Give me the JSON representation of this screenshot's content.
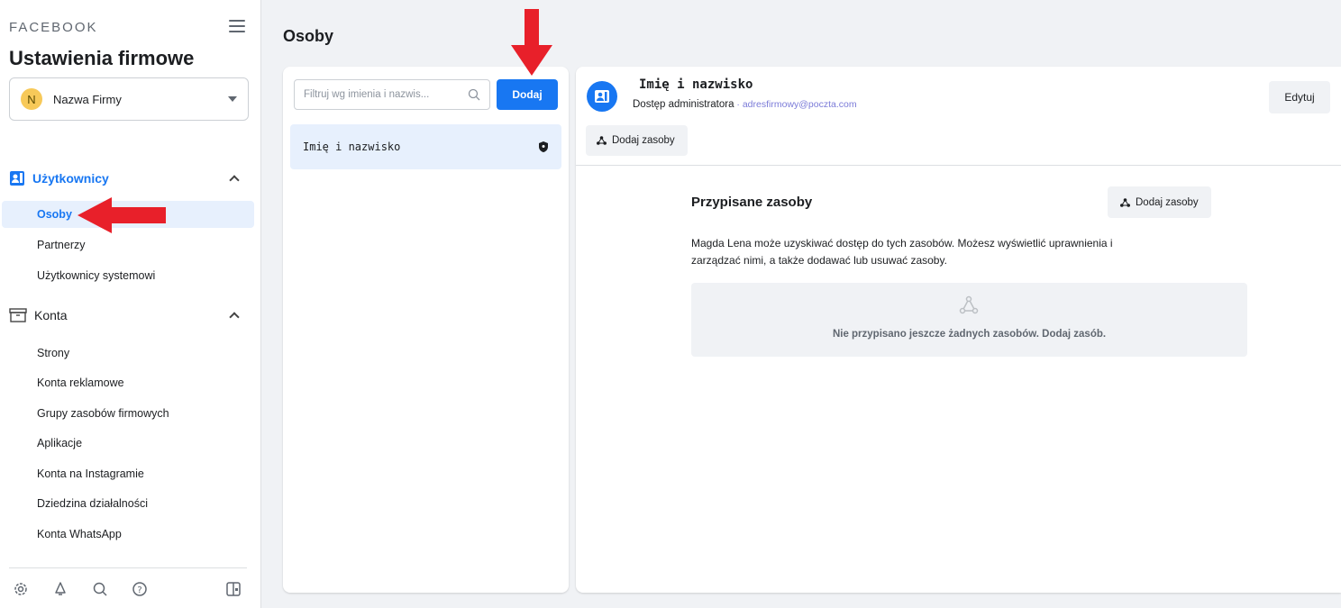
{
  "sidebar": {
    "brand": "FACEBOOK",
    "title": "Ustawienia firmowe",
    "business": {
      "initial": "N",
      "name": "Nazwa Firmy"
    },
    "users_section": {
      "label": "Użytkownicy",
      "items": [
        "Osoby",
        "Partnerzy",
        "Użytkownicy systemowi"
      ]
    },
    "accounts_section": {
      "label": "Konta",
      "items": [
        "Strony",
        "Konta reklamowe",
        "Grupy zasobów firmowych",
        "Aplikacje",
        "Konta na Instagramie",
        "Dziedzina działalności",
        "Konta WhatsApp"
      ]
    }
  },
  "main": {
    "page_title": "Osoby",
    "list": {
      "search_placeholder": "Filtruj wg imienia i nazwis...",
      "add_label": "Dodaj",
      "people": [
        {
          "name": "Imię i nazwisko"
        }
      ]
    },
    "detail": {
      "name": "Imię i nazwisko",
      "role": "Dostęp administratora",
      "separator": " · ",
      "email": "adresfirmowy@poczta.com",
      "edit_label": "Edytuj",
      "add_assets_label": "Dodaj zasoby",
      "assigned_title": "Przypisane zasoby",
      "assigned_add_label": "Dodaj zasoby",
      "assigned_desc_line1": "Magda Lena może uzyskiwać dostęp do tych zasobów. Możesz wyświetlić uprawnienia i",
      "assigned_desc_line2": "zarządzać nimi, a także dodawać lub usuwać zasoby.",
      "empty_text": "Nie przypisano jeszcze żadnych zasobów. Dodaj zasób."
    }
  },
  "colors": {
    "accent": "#1877f2",
    "active_bg": "#e7f0fd",
    "annotation_arrow": "#e8202a",
    "avatar_yellow": "#f7c959"
  },
  "icons": {
    "menu": "hamburger-icon",
    "users": "users-icon",
    "accounts": "briefcase-icon",
    "search": "search-icon",
    "admin": "shield-icon",
    "assets": "asset-nodes-icon",
    "footer": [
      "settings-icon",
      "bell-icon",
      "search-icon",
      "help-icon",
      "panel-toggle-icon"
    ]
  }
}
